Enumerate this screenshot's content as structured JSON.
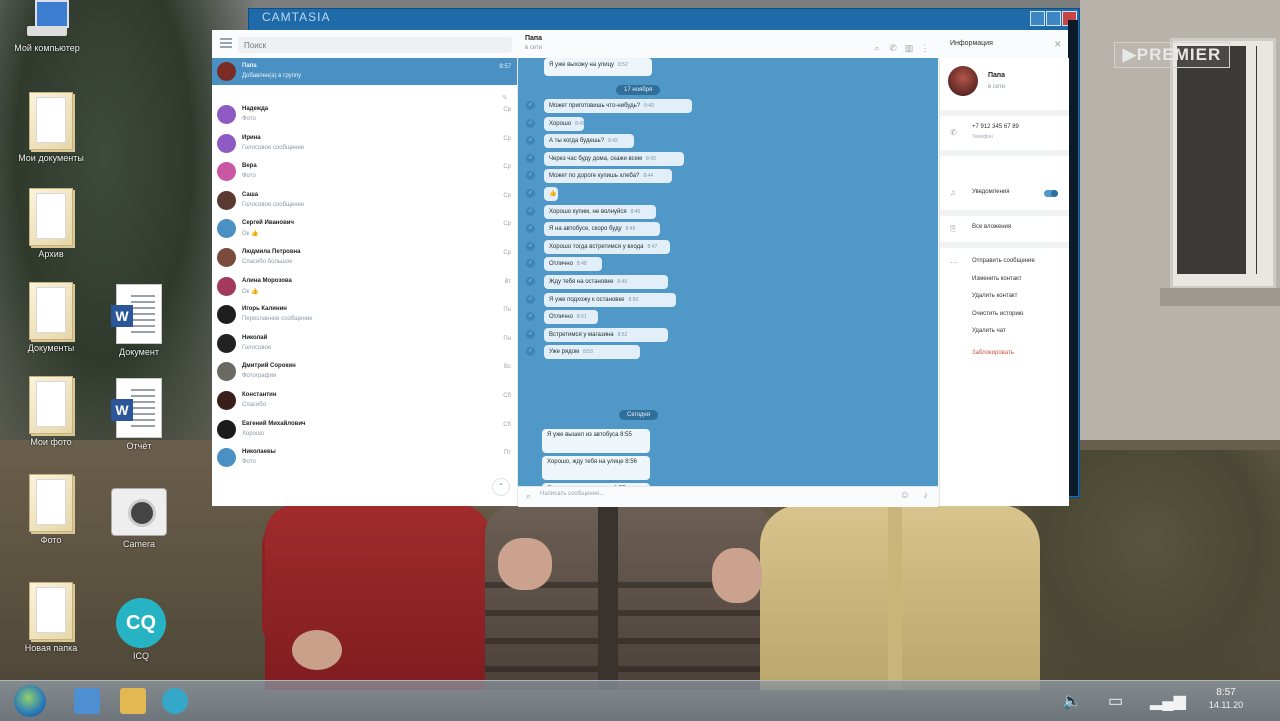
{
  "window": {
    "back_title": "CAMTASIA",
    "search_placeholder": "Поиск",
    "panel_title": "Информация",
    "chat_name": "Папа",
    "chat_status": "в сети"
  },
  "chats": [
    {
      "name": "Папа",
      "msg": "Добавлен(а) в группу",
      "time": "8:57",
      "color": "#7a2c24",
      "active": true
    },
    {
      "name": "Надежда",
      "msg": "Фото",
      "time": "Ср",
      "color": "#8e5ac4"
    },
    {
      "name": "Ирина",
      "msg": "Голосовое сообщение",
      "time": "Ср",
      "color": "#8e5ac4"
    },
    {
      "name": "Вера",
      "msg": "Фото",
      "time": "Ср",
      "color": "#c957a4"
    },
    {
      "name": "Саша",
      "msg": "Голосовое сообщение",
      "time": "Ср",
      "color": "#5a3a30"
    },
    {
      "name": "Сергей Иванович",
      "msg": "Ок 👍",
      "time": "Ср",
      "color": "#4a90c2"
    },
    {
      "name": "Людмила Петровна",
      "msg": "Спасибо большое",
      "time": "Ср",
      "color": "#7a4a3a"
    },
    {
      "name": "Алина Морозова",
      "msg": "Ок 👍",
      "time": "Вт",
      "color": "#a13a5c"
    },
    {
      "name": "Игорь Калинин",
      "msg": "Пересланное сообщение",
      "time": "Пн",
      "color": "#1e1e1e"
    },
    {
      "name": "Николай",
      "msg": "Голосовое",
      "time": "Пн",
      "color": "#222222"
    },
    {
      "name": "Дмитрий Сорокин",
      "msg": "Фотография",
      "time": "Вс",
      "color": "#6a6a62"
    },
    {
      "name": "Константин",
      "msg": "Спасибо",
      "time": "Сб",
      "color": "#3a1e1a"
    },
    {
      "name": "Евгений Михайлович",
      "msg": "Хорошо",
      "time": "Сб",
      "color": "#1b1b1b"
    },
    {
      "name": "Николаевы",
      "msg": "Фото",
      "time": "Пт",
      "color": "#4a90c2"
    }
  ],
  "messages": {
    "top": "Я уже выхожу на улицу",
    "top_time": "8:52",
    "date1": "17 ноября",
    "list1": [
      {
        "text": "Может приготовишь что-нибудь?",
        "time": "8:40"
      },
      {
        "text": "Хорошо",
        "time": "8:41"
      },
      {
        "text": "А ты когда будешь?",
        "time": "8:42"
      },
      {
        "text": "Через час буду дома, скажи всем",
        "time": "8:43"
      },
      {
        "text": "Может по дороге купишь хлеба?",
        "time": "8:44"
      },
      {
        "text": "👍",
        "time": ""
      },
      {
        "text": "Хорошо купим, не волнуйся",
        "time": "8:45"
      },
      {
        "text": "Я на автобусе, скоро буду",
        "time": "8:46"
      },
      {
        "text": "Хорошо тогда встретимся у входа",
        "time": "8:47"
      },
      {
        "text": "Отлично",
        "time": "8:48"
      },
      {
        "text": "Жду тебя на остановке",
        "time": "8:49"
      },
      {
        "text": "Я уже подхожу к остановке",
        "time": "8:50"
      },
      {
        "text": "Отлично",
        "time": "8:51"
      },
      {
        "text": "Встретимся у магазина",
        "time": "8:52"
      },
      {
        "text": "Уже рядом",
        "time": "8:53"
      }
    ],
    "date2": "Сегодня",
    "list2": [
      {
        "text": "Я уже вышел из автобуса",
        "time": "8:55"
      },
      {
        "text": "Хорошо, жду тебя на улице",
        "time": "8:56"
      },
      {
        "text": "Я уже выхожу на улицу",
        "time": "8:57"
      }
    ],
    "composer_placeholder": "Написать сообщение..."
  },
  "info": {
    "name": "Папа",
    "status": "в сети",
    "phone": "+7 912 345 67 89",
    "phone_label": "Телефон",
    "notifications": "Уведомления",
    "media": "Все вложения",
    "actions": [
      "Отправить сообщение",
      "Изменить контакт",
      "Удалить контакт",
      "Очистить историю",
      "Удалить чат",
      "Заблокировать"
    ]
  },
  "desktop_icons": [
    {
      "label": "Мой компьютер"
    },
    {
      "label": "Мои документы"
    },
    {
      "label": "Архив"
    },
    {
      "label": "Документы"
    },
    {
      "label": "Документ"
    },
    {
      "label": "Мои фото"
    },
    {
      "label": "Отчёт"
    },
    {
      "label": "Фото"
    },
    {
      "label": "Camera"
    },
    {
      "label": "Новая папка"
    },
    {
      "label": "ICQ"
    }
  ],
  "watermark": "▶PREMIER",
  "taskbar": {
    "time": "8:57",
    "date": "14.11.20"
  },
  "colors": {
    "chat_bg": "#4f98c7",
    "active_row": "#4a90c2",
    "bubble": "#e3eff8"
  }
}
